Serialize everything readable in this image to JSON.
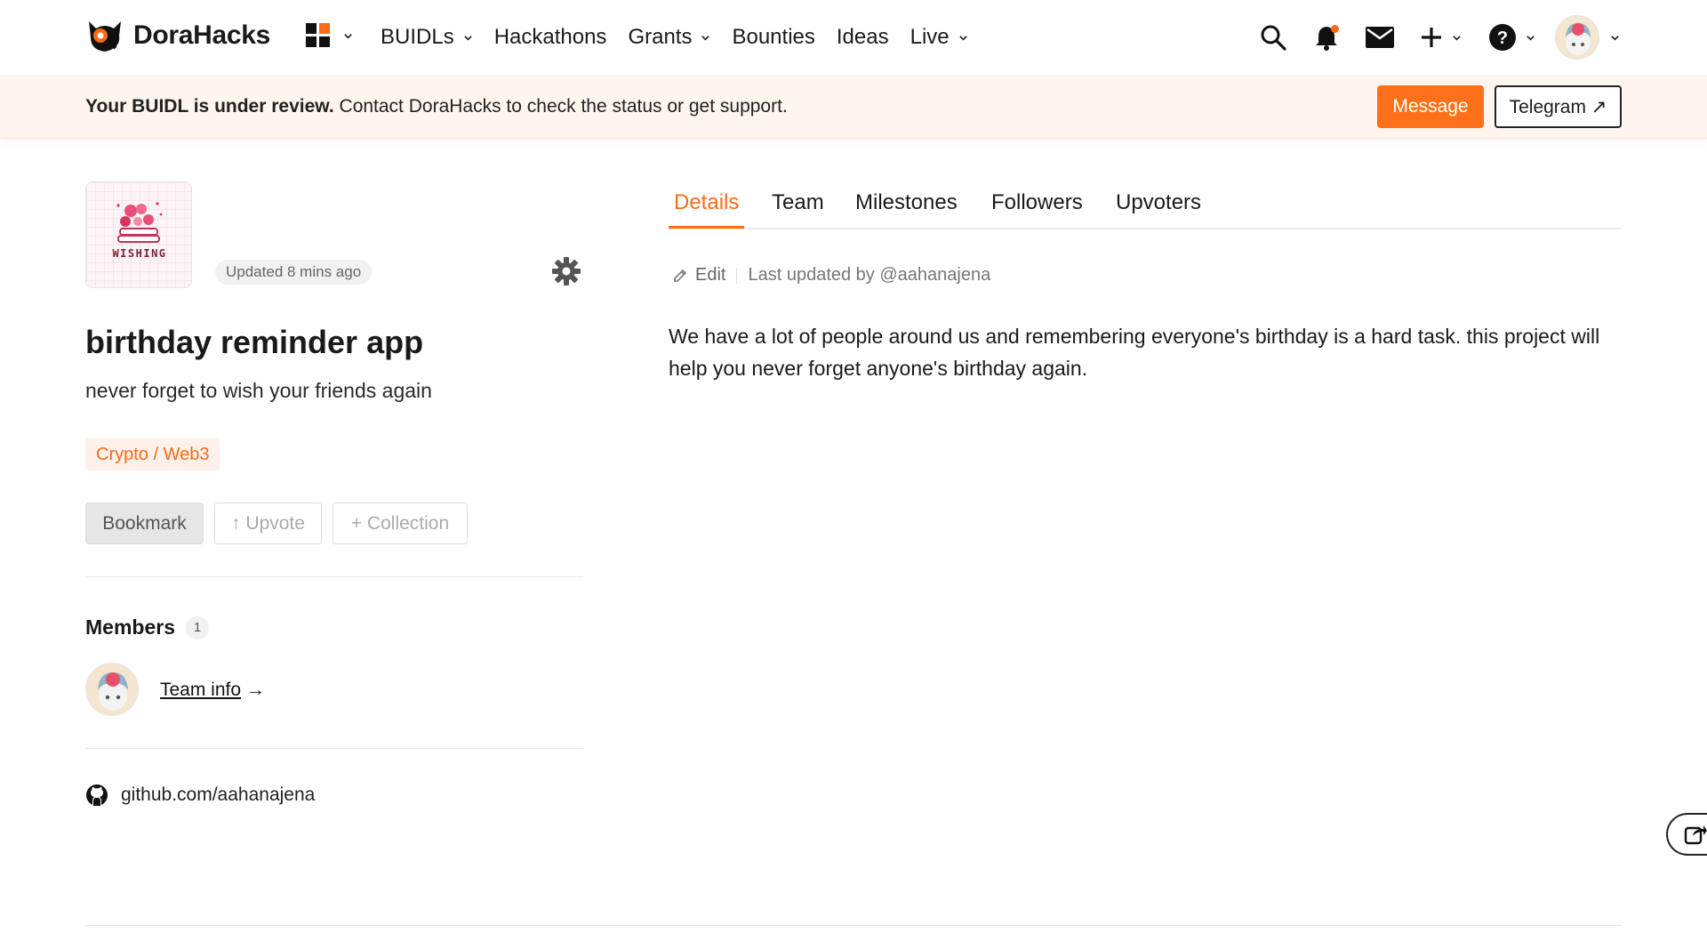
{
  "brand": {
    "name": "DoraHacks",
    "accent": "#ff6a13"
  },
  "nav": {
    "items": [
      {
        "label": "BUIDLs",
        "has_dropdown": true
      },
      {
        "label": "Hackathons",
        "has_dropdown": false
      },
      {
        "label": "Grants",
        "has_dropdown": true
      },
      {
        "label": "Bounties",
        "has_dropdown": false
      },
      {
        "label": "Ideas",
        "has_dropdown": false
      },
      {
        "label": "Live",
        "has_dropdown": true
      }
    ],
    "right_icons": [
      "search-icon",
      "bell-icon",
      "mail-icon",
      "plus-icon",
      "help-icon",
      "avatar"
    ]
  },
  "banner": {
    "bold": "Your BUIDL is under review.",
    "text": " Contact DoraHacks to check the status or get support.",
    "message_label": "Message",
    "telegram_label": "Telegram ↗"
  },
  "project": {
    "logo_text": "WISHING",
    "updated": "Updated 8 mins ago",
    "title": "birthday reminder app",
    "tagline": "never forget to wish your friends again",
    "tag": "Crypto / Web3",
    "actions": {
      "bookmark": "Bookmark",
      "upvote": "↑ Upvote",
      "collection": "+ Collection"
    }
  },
  "members": {
    "title": "Members",
    "count": "1",
    "team_link": "Team info",
    "arrow": " →"
  },
  "github": {
    "link": "github.com/aahanajena"
  },
  "tabs": [
    {
      "label": "Details",
      "active": true
    },
    {
      "label": "Team",
      "active": false
    },
    {
      "label": "Milestones",
      "active": false
    },
    {
      "label": "Followers",
      "active": false
    },
    {
      "label": "Upvoters",
      "active": false
    }
  ],
  "details": {
    "edit_label": "Edit",
    "last_updated": "Last updated by @aahanajena",
    "description": "We have a lot of people around us and remembering everyone's birthday is a hard task. this project will help you never forget anyone's birthday again."
  }
}
